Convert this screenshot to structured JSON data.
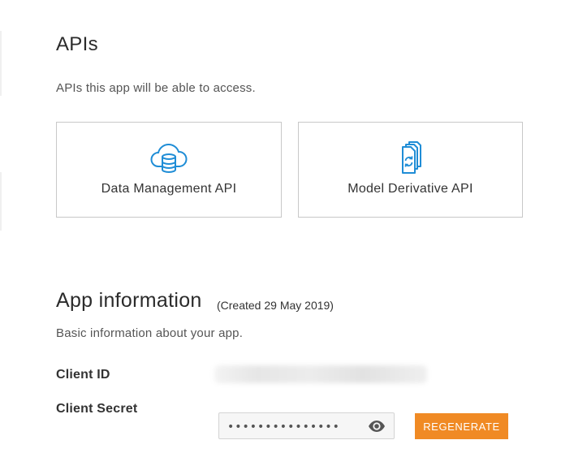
{
  "apis": {
    "title": "APIs",
    "description": "APIs this app will be able to access.",
    "cards": [
      {
        "label": "Data Management API",
        "icon": "cloud-database-icon"
      },
      {
        "label": "Model Derivative API",
        "icon": "documents-sync-icon"
      }
    ]
  },
  "app_info": {
    "title": "App information",
    "created": "(Created 29 May 2019)",
    "description": "Basic information about your app.",
    "client_id_label": "Client ID",
    "client_secret_label": "Client Secret",
    "client_secret_value": "•••••••••••••••",
    "regenerate_label": "REGENERATE"
  },
  "colors": {
    "accent": "#f08a24",
    "icon_blue": "#1f8dd6",
    "border": "#c8c8c8"
  }
}
